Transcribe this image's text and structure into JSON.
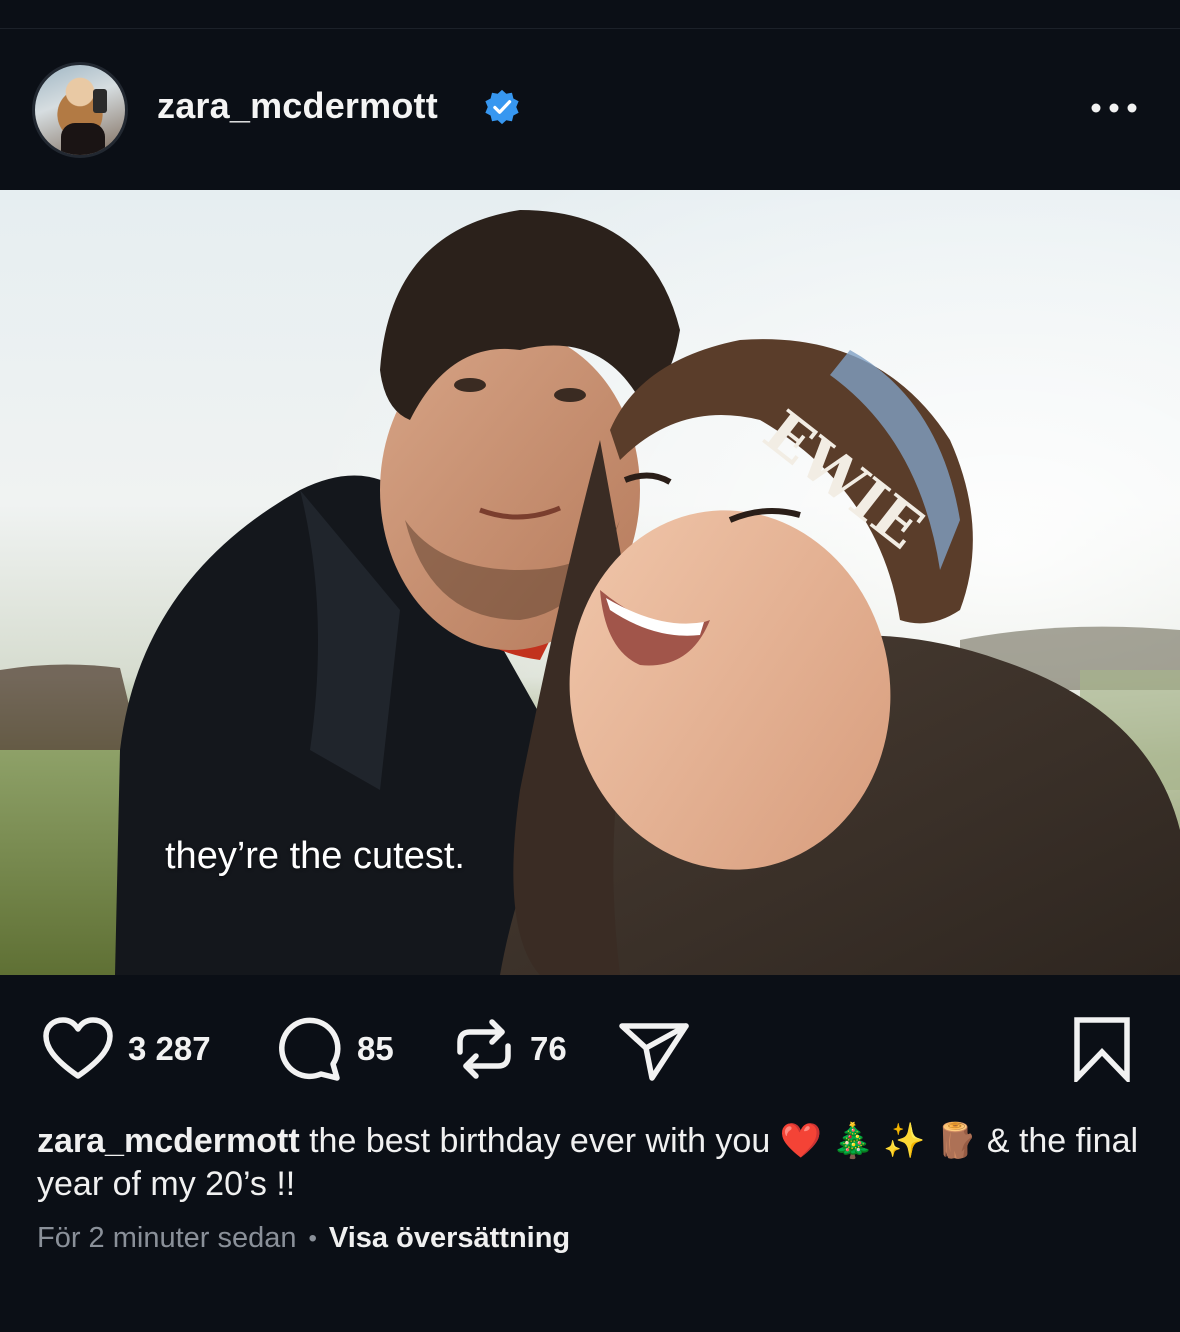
{
  "post": {
    "username": "zara_mcdermott",
    "verified": true,
    "avatar_icon": "avatar",
    "more_icon": "more-options-icon"
  },
  "media": {
    "overlay_text": "they’re the cutest.",
    "hat_text": "EWIE"
  },
  "actions": {
    "likes": "3 287",
    "comments": "85",
    "reposts": "76"
  },
  "caption": {
    "username": "zara_mcdermott",
    "text": "the best birthday ever with you ❤️ 🎄 ✨ 🪵 & the final year of my 20’s !!"
  },
  "meta": {
    "time": "För 2 minuter sedan",
    "separator": "•",
    "translate": "Visa översättning"
  },
  "colors": {
    "background": "#0b0f16",
    "verified_blue": "#3797f0",
    "muted": "#8a9099"
  }
}
